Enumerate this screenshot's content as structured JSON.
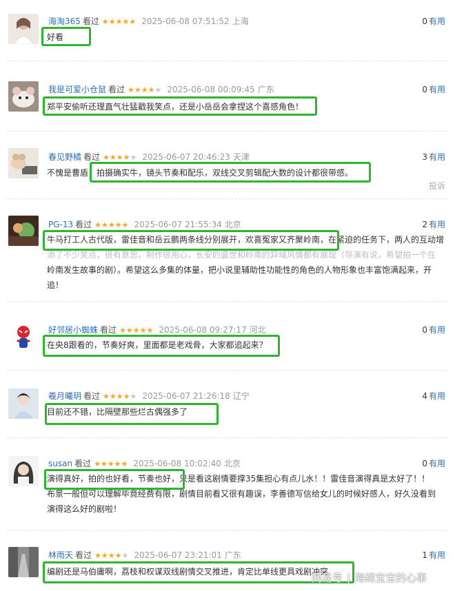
{
  "saw_label": "看过",
  "useful_label": "有用",
  "report_label": "投诉",
  "watermark": {
    "brand": "网易号",
    "author": "海绵宝宝的心事"
  },
  "reviews": [
    {
      "user": "海淘365",
      "rating": 5,
      "time": "2025-06-08 07:51:52",
      "location": "上海",
      "useful": "0",
      "lines": [
        "好看"
      ]
    },
    {
      "user": "我是可爱小仓鼠",
      "rating": 4,
      "time": "2025-06-08 00:09:45",
      "location": "广东",
      "useful": "0",
      "lines": [
        "郑平安偷听还理直气壮猛戳我笑点，还是小岳岳会拿捏这个喜感角色！"
      ]
    },
    {
      "user": "春见野橘",
      "rating": 4,
      "time": "2025-06-07 20:46:23",
      "location": "天津",
      "useful": "3",
      "lines": [
        "不愧是曹盾，拍摄确实牛，镜头节奏和配乐，双线交叉剪辑配大数的设计都很带感。"
      ]
    },
    {
      "user": "PG-13",
      "rating": 5,
      "time": "2025-06-07 21:55:34",
      "location": "北京",
      "useful": "2",
      "lines": [
        "牛马打工人古代版，雷佳音和岳云鹏两条线分别展开，欢喜冤家又齐聚岭南，在紧迫的任务下，两人的互动增",
        "添了不少笑点，很有意思。制作很用心，长安的盛世和岭南的异域风情都有展现（导演有说，希望拍一个在",
        "岭南发生故事的剧）。希望这么多集的体量，把小说里辅助性功能性的角色的人物形象也丰富饱满起来，开",
        "追！"
      ]
    },
    {
      "user": "好邻居小蜘蛛",
      "rating": 5,
      "time": "2025-06-08 09:27:17",
      "location": "河北",
      "useful": "0",
      "lines": [
        "在央8跟看的，节奏好爽，里面都是老戏骨，大家都追起来？"
      ]
    },
    {
      "user": "羲月曦玥",
      "rating": 4,
      "time": "2025-06-07 21:26:18",
      "location": "辽宁",
      "useful": "4",
      "lines": [
        "目前还不错，比隔壁那些烂古偶强多了"
      ]
    },
    {
      "user": "susan",
      "rating": 5,
      "time": "2025-06-08 10:02:40",
      "location": "北京",
      "useful": "0",
      "lines": [
        "演得真好，拍的也好看，节奏也好，只是看这剧情要撑35集担心有点儿水！！雷佳音演得真是太好了！！",
        "布景一般但可以理解毕竟经费有限，剧情目前看又很有趣误，李善德写信给女儿的时候好感人，好久没看到",
        "演得这么好的剧啦！"
      ]
    },
    {
      "user": "林雨天",
      "rating": 4,
      "time": "2025-06-07 23:21:01",
      "location": "广东",
      "useful": "1",
      "lines": [
        "编剧还是马伯庸啊，荔枝和权谋双线剧情交叉推进，肯定比单线更具戏剧冲突"
      ]
    }
  ]
}
